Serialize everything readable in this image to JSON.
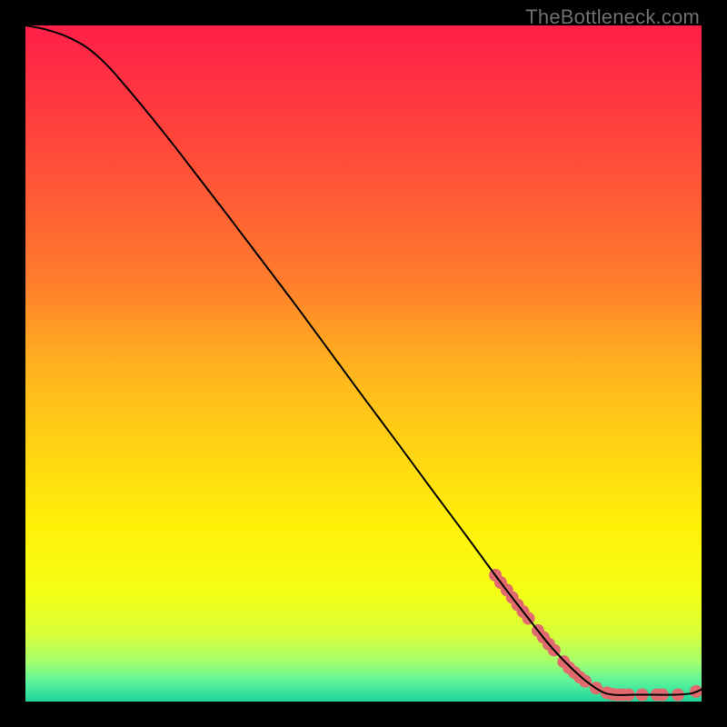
{
  "watermark": "TheBottleneck.com",
  "chart_data": {
    "type": "line",
    "title": "",
    "xlabel": "",
    "ylabel": "",
    "xlim": [
      0,
      100
    ],
    "ylim": [
      0,
      100
    ],
    "grid": false,
    "legend": false,
    "background_gradient": {
      "type": "vertical",
      "stops": [
        {
          "offset": 0.0,
          "color": "#ff1f47"
        },
        {
          "offset": 0.12,
          "color": "#ff3a3f"
        },
        {
          "offset": 0.25,
          "color": "#ff5a35"
        },
        {
          "offset": 0.38,
          "color": "#ff7e2c"
        },
        {
          "offset": 0.5,
          "color": "#ffb11f"
        },
        {
          "offset": 0.62,
          "color": "#ffd213"
        },
        {
          "offset": 0.74,
          "color": "#fff108"
        },
        {
          "offset": 0.84,
          "color": "#f4ff15"
        },
        {
          "offset": 0.9,
          "color": "#d8ff3a"
        },
        {
          "offset": 0.94,
          "color": "#a6ff6a"
        },
        {
          "offset": 0.97,
          "color": "#5cf49c"
        },
        {
          "offset": 1.0,
          "color": "#1ed49a"
        }
      ]
    },
    "series": [
      {
        "name": "curve",
        "color": "#000000",
        "stroke_width": 2,
        "points": [
          {
            "x": 0.0,
            "y": 100.0
          },
          {
            "x": 3.0,
            "y": 99.4
          },
          {
            "x": 6.0,
            "y": 98.4
          },
          {
            "x": 9.0,
            "y": 96.8
          },
          {
            "x": 12.0,
            "y": 94.2
          },
          {
            "x": 15.0,
            "y": 90.8
          },
          {
            "x": 18.0,
            "y": 87.2
          },
          {
            "x": 22.0,
            "y": 82.2
          },
          {
            "x": 26.0,
            "y": 77.0
          },
          {
            "x": 30.0,
            "y": 71.8
          },
          {
            "x": 35.0,
            "y": 65.2
          },
          {
            "x": 40.0,
            "y": 58.6
          },
          {
            "x": 45.0,
            "y": 51.8
          },
          {
            "x": 50.0,
            "y": 45.0
          },
          {
            "x": 55.0,
            "y": 38.3
          },
          {
            "x": 60.0,
            "y": 31.5
          },
          {
            "x": 65.0,
            "y": 24.8
          },
          {
            "x": 70.0,
            "y": 18.0
          },
          {
            "x": 74.0,
            "y": 12.8
          },
          {
            "x": 78.0,
            "y": 7.8
          },
          {
            "x": 82.0,
            "y": 3.8
          },
          {
            "x": 85.0,
            "y": 1.6
          },
          {
            "x": 87.0,
            "y": 1.0
          },
          {
            "x": 90.0,
            "y": 1.0
          },
          {
            "x": 93.0,
            "y": 1.0
          },
          {
            "x": 96.0,
            "y": 1.0
          },
          {
            "x": 98.5,
            "y": 1.2
          },
          {
            "x": 100.0,
            "y": 1.8
          }
        ]
      }
    ],
    "markers": {
      "name": "highlight-dots",
      "color": "#e06a6d",
      "radius": 7,
      "points": [
        {
          "x": 69.5,
          "y": 18.7
        },
        {
          "x": 70.3,
          "y": 17.6
        },
        {
          "x": 71.2,
          "y": 16.5
        },
        {
          "x": 72.0,
          "y": 15.4
        },
        {
          "x": 72.8,
          "y": 14.3
        },
        {
          "x": 73.6,
          "y": 13.3
        },
        {
          "x": 74.4,
          "y": 12.3
        },
        {
          "x": 75.8,
          "y": 10.5
        },
        {
          "x": 76.6,
          "y": 9.5
        },
        {
          "x": 77.4,
          "y": 8.5
        },
        {
          "x": 78.2,
          "y": 7.6
        },
        {
          "x": 79.6,
          "y": 5.9
        },
        {
          "x": 80.4,
          "y": 5.0
        },
        {
          "x": 81.2,
          "y": 4.3
        },
        {
          "x": 82.0,
          "y": 3.6
        },
        {
          "x": 82.8,
          "y": 3.0
        },
        {
          "x": 84.4,
          "y": 2.0
        },
        {
          "x": 86.0,
          "y": 1.3
        },
        {
          "x": 86.8,
          "y": 1.1
        },
        {
          "x": 87.6,
          "y": 1.0
        },
        {
          "x": 88.4,
          "y": 1.0
        },
        {
          "x": 89.2,
          "y": 1.0
        },
        {
          "x": 91.2,
          "y": 1.0
        },
        {
          "x": 93.4,
          "y": 1.0
        },
        {
          "x": 94.2,
          "y": 1.0
        },
        {
          "x": 96.5,
          "y": 1.0
        },
        {
          "x": 99.2,
          "y": 1.5
        }
      ]
    }
  }
}
